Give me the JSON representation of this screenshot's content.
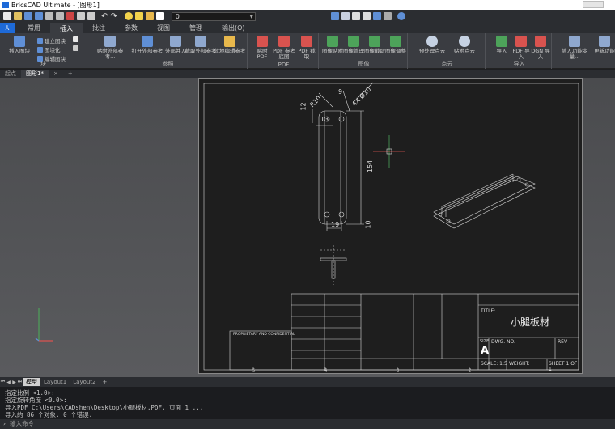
{
  "window": {
    "title": "BricsCAD Ultimate - [图形1]"
  },
  "toolbar": {
    "layer_value": "0"
  },
  "ribbon": {
    "tabs": [
      "常用",
      "插入",
      "批注",
      "参数",
      "视图",
      "管理",
      "输出(O)"
    ],
    "active_tab": "插入",
    "block_group": {
      "label": "块",
      "insert_block": "插入图块",
      "create_block": "建立图块",
      "block_ization": "图块化",
      "edit_block": "编辑图块"
    },
    "reference_group": {
      "label": "参照",
      "buttons": [
        "贴附外部参考...",
        "打开外部参考",
        "外部并入",
        "截取外部参考",
        "就地编辑参考"
      ]
    },
    "pdf_group": {
      "label": "PDF",
      "buttons": [
        "贴附 PDF",
        "PDF 参考底图",
        "PDF 截取"
      ]
    },
    "image_group": {
      "label": "图像",
      "buttons": [
        "图像贴附",
        "图像管理",
        "图像截取",
        "图像调整"
      ]
    },
    "pointcloud_group": {
      "label": "点云",
      "buttons": [
        "预处理点云",
        "贴附点云"
      ]
    },
    "import_group": {
      "label": "导入",
      "buttons": [
        "导入",
        "PDF 导入",
        "DGN 导入"
      ]
    },
    "extra_buttons": [
      "插入功能变量...",
      "更新功能"
    ]
  },
  "doc_tabs": [
    "起点",
    "图形1*"
  ],
  "drawing": {
    "dims": {
      "r10_top": "R10",
      "r10_right": "R10",
      "d9": "9",
      "d12": "12",
      "d13": "13",
      "d45": "4X Ø10",
      "d154": "154",
      "d19": "19",
      "d10": "10"
    },
    "title_block": {
      "title_label": "TITLE:",
      "title_value": "小腿板材",
      "size_label": "SIZE",
      "size_value": "A",
      "dwg_no": "DWG. NO.",
      "rev": "REV",
      "scale": "SCALE: 1:5",
      "weight": "WEIGHT:",
      "sheet": "SHEET 1 OF 1",
      "proprietary": "PROPRIETARY AND CONFIDENTIAL"
    },
    "zone_numbers": [
      "5",
      "4",
      "3",
      "2"
    ]
  },
  "layout_tabs": [
    "模型",
    "Layout1",
    "Layout2",
    "+"
  ],
  "command_lines": [
    "指定比例 <1.0>:",
    "指定旋转角度 <0.0>:",
    "导入PDF C:\\Users\\CADshen\\Desktop\\小腿板材.PDF, 页面 1 ...",
    "导入的 86 个对象. 0 个错误."
  ],
  "command_prompt": "输入命令"
}
